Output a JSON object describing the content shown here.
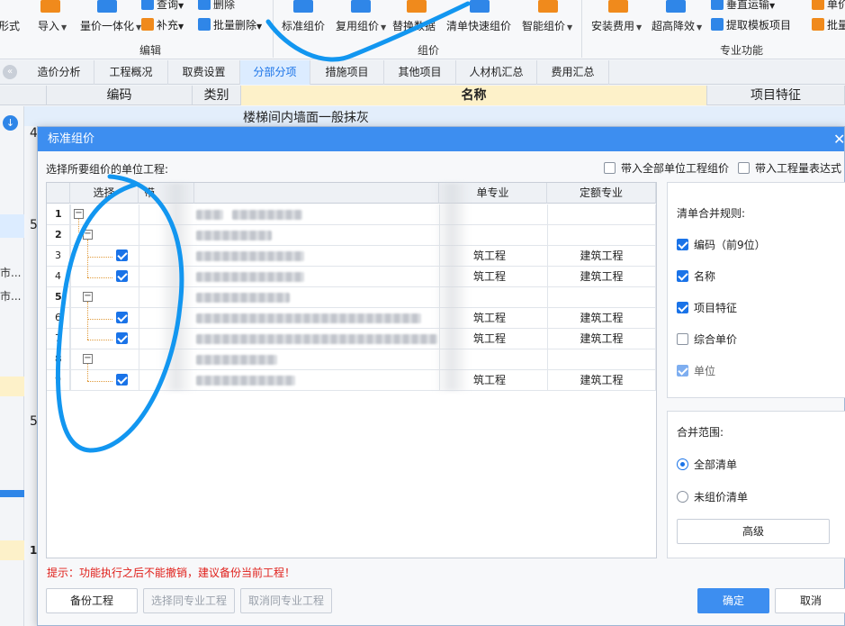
{
  "ribbon": {
    "top_partial": [
      "查询",
      "删除",
      "垂直运输"
    ],
    "left_partial": "形式",
    "right_partial_top": "单价",
    "right_partial_mid": "批量",
    "buttons": {
      "import": "导入",
      "price_integration": "量价一体化",
      "supplement": "补充",
      "batch_delete": "批量删除",
      "standard_group": "标准组价",
      "reuse_group": "复用组价",
      "replace_data": "替换数据",
      "quick_group": "清单快速组价",
      "smart_group": "智能组价",
      "install_fee": "安装费用",
      "high_reduction": "超高降效",
      "extract_template": "提取模板项目"
    },
    "groups": {
      "edit": "编辑",
      "group_price": "组价",
      "professional": "专业功能"
    }
  },
  "tabs": [
    "造价分析",
    "工程概况",
    "取费设置",
    "分部分项",
    "措施项目",
    "其他项目",
    "人材机汇总",
    "费用汇总"
  ],
  "active_tab": "分部分项",
  "bg_grid": {
    "headers": {
      "code": "编码",
      "type": "类别",
      "name": "名称",
      "feature": "项目特征"
    },
    "first_row_name": "楼梯间内墙面一般抹灰",
    "left_numbers": [
      "4",
      "5",
      "5",
      "1"
    ],
    "left_partial_1": "市...",
    "left_partial_2": "市..."
  },
  "dialog": {
    "title": "标准组价",
    "subtitle": "选择所要组价的单位工程:",
    "opt_all_units": "带入全部单位工程组价",
    "opt_quantity_expr": "带入工程量表达式",
    "table": {
      "headers": {
        "select": "选择",
        "col_partial_1": "带",
        "col_partial_2": "单专业",
        "quota_major": "定额专业"
      },
      "rows": [
        {
          "num": "1",
          "group": true
        },
        {
          "num": "2",
          "group": true
        },
        {
          "num": "3",
          "checked": true,
          "major": "筑工程",
          "quota": "建筑工程"
        },
        {
          "num": "4",
          "checked": true,
          "major": "筑工程",
          "quota": "建筑工程"
        },
        {
          "num": "5",
          "group": true
        },
        {
          "num": "6",
          "checked": true,
          "major": "筑工程",
          "quota": "建筑工程"
        },
        {
          "num": "7",
          "checked": true,
          "major": "筑工程",
          "quota": "建筑工程"
        },
        {
          "num": "8",
          "group": true
        },
        {
          "num": "9",
          "checked": true,
          "major": "筑工程",
          "quota": "建筑工程"
        }
      ]
    },
    "merge_rules": {
      "title": "清单合并规则:",
      "items": [
        {
          "label": "编码（前9位）",
          "checked": true
        },
        {
          "label": "名称",
          "checked": true
        },
        {
          "label": "项目特征",
          "checked": true
        },
        {
          "label": "综合单价",
          "checked": false
        },
        {
          "label": "单位",
          "checked": true
        }
      ]
    },
    "merge_scope": {
      "title": "合并范围:",
      "options": [
        {
          "label": "全部清单",
          "selected": true
        },
        {
          "label": "未组价清单",
          "selected": false
        }
      ],
      "advanced": "高级"
    },
    "hint": "提示：功能执行之后不能撤销，建议备份当前工程！",
    "buttons": {
      "backup": "备份工程",
      "select_same": "选择同专业工程",
      "cancel_same": "取消同专业工程",
      "ok": "确定",
      "cancel": "取消"
    }
  },
  "colors": {
    "accent": "#3d8ef0",
    "hint": "#e0201b",
    "annotation": "#1296f0",
    "name_header": "#fdf1c9"
  }
}
